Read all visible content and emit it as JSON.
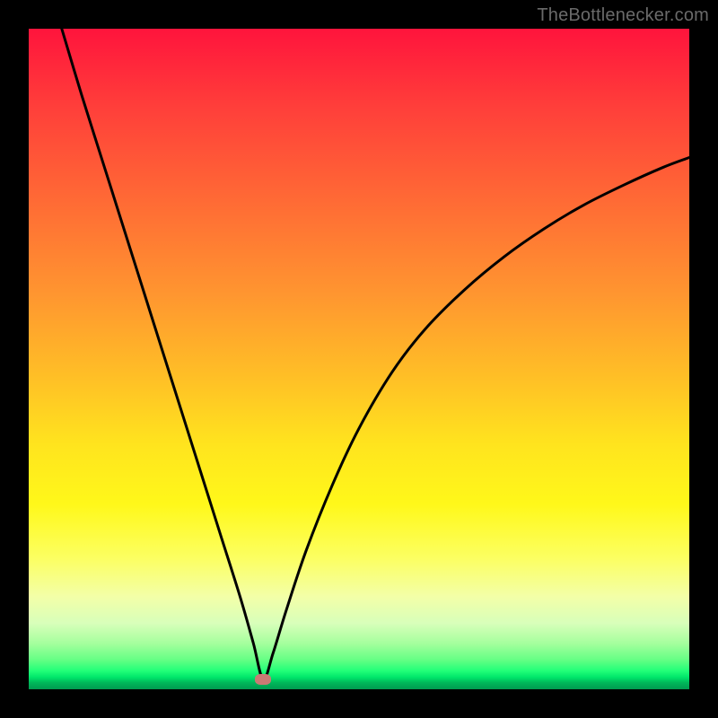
{
  "attribution": "TheBottlenecker.com",
  "colors": {
    "curve_stroke": "#000000",
    "dot_fill": "#cb7a74",
    "frame": "#000000"
  },
  "chart_data": {
    "type": "line",
    "title": "",
    "xlabel": "",
    "ylabel": "",
    "xlim": [
      0,
      100
    ],
    "ylim": [
      0,
      100
    ],
    "grid": false,
    "legend": false,
    "annotations": [
      {
        "kind": "marker",
        "shape": "pill",
        "x": 35.5,
        "y": 1.5
      }
    ],
    "series": [
      {
        "name": "bottleneck-curve",
        "x": [
          5,
          8,
          11,
          14,
          17,
          20,
          23,
          26,
          29,
          32,
          34,
          35.5,
          37,
          39,
          42,
          46,
          50,
          55,
          60,
          66,
          72,
          78,
          84,
          90,
          96,
          100
        ],
        "y": [
          100,
          90,
          80.5,
          71,
          61.5,
          52,
          42.5,
          33,
          23.5,
          14,
          7,
          1.5,
          5.5,
          12,
          21,
          31,
          39.5,
          48,
          54.5,
          60.5,
          65.5,
          69.7,
          73.3,
          76.3,
          79,
          80.5
        ]
      }
    ]
  }
}
